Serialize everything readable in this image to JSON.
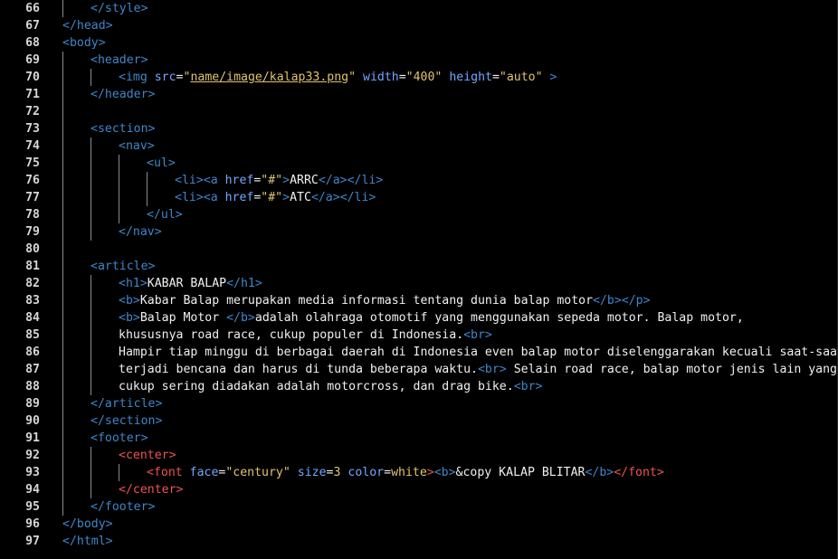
{
  "editor": {
    "colors": {
      "background": "#000000",
      "tag": "#3f86c9",
      "attribute": "#6fa8ff",
      "string": "#e0c46c",
      "center_tag": "#ef5350",
      "text": "#f0f0f0",
      "line_number": "#d6d6d6"
    },
    "lines": [
      {
        "n": "66",
        "indent": 1,
        "tokens": [
          {
            "t": "</style>",
            "c": "tag"
          }
        ]
      },
      {
        "n": "67",
        "indent": 0,
        "tokens": [
          {
            "t": "</head>",
            "c": "tag"
          }
        ]
      },
      {
        "n": "68",
        "indent": 0,
        "tokens": [
          {
            "t": "<body>",
            "c": "tag"
          }
        ]
      },
      {
        "n": "69",
        "indent": 1,
        "tokens": [
          {
            "t": "<header>",
            "c": "tag"
          }
        ]
      },
      {
        "n": "70",
        "indent": 2,
        "tokens": [
          {
            "t": "<img ",
            "c": "tag"
          },
          {
            "t": "src",
            "c": "attr"
          },
          {
            "t": "=",
            "c": "txt"
          },
          {
            "t": "\"",
            "c": "str"
          },
          {
            "t": "name/image/kalap33.png",
            "c": "strl"
          },
          {
            "t": "\"",
            "c": "str"
          },
          {
            "t": " ",
            "c": "txt"
          },
          {
            "t": "width",
            "c": "attr"
          },
          {
            "t": "=",
            "c": "txt"
          },
          {
            "t": "\"400\"",
            "c": "str"
          },
          {
            "t": " ",
            "c": "txt"
          },
          {
            "t": "height",
            "c": "attr"
          },
          {
            "t": "=",
            "c": "txt"
          },
          {
            "t": "\"auto\"",
            "c": "str"
          },
          {
            "t": " >",
            "c": "tag"
          }
        ]
      },
      {
        "n": "71",
        "indent": 1,
        "tokens": [
          {
            "t": "</header>",
            "c": "tag"
          }
        ]
      },
      {
        "n": "72",
        "indent": 0,
        "tokens": []
      },
      {
        "n": "73",
        "indent": 1,
        "tokens": [
          {
            "t": "<section>",
            "c": "tag"
          }
        ]
      },
      {
        "n": "74",
        "indent": 2,
        "tokens": [
          {
            "t": "<nav>",
            "c": "tag"
          }
        ]
      },
      {
        "n": "75",
        "indent": 3,
        "tokens": [
          {
            "t": "<ul>",
            "c": "tag"
          }
        ]
      },
      {
        "n": "76",
        "indent": 4,
        "tokens": [
          {
            "t": "<li><a ",
            "c": "tag"
          },
          {
            "t": "href",
            "c": "attr"
          },
          {
            "t": "=",
            "c": "txt"
          },
          {
            "t": "\"#\"",
            "c": "str"
          },
          {
            "t": ">",
            "c": "tag"
          },
          {
            "t": "ARRC",
            "c": "txt"
          },
          {
            "t": "</a></li>",
            "c": "tag"
          }
        ]
      },
      {
        "n": "77",
        "indent": 4,
        "tokens": [
          {
            "t": "<li><a ",
            "c": "tag"
          },
          {
            "t": "href",
            "c": "attr"
          },
          {
            "t": "=",
            "c": "txt"
          },
          {
            "t": "\"#\"",
            "c": "str"
          },
          {
            "t": ">",
            "c": "tag"
          },
          {
            "t": "ATC",
            "c": "txt"
          },
          {
            "t": "</a></li>",
            "c": "tag"
          }
        ]
      },
      {
        "n": "78",
        "indent": 3,
        "tokens": [
          {
            "t": "</ul>",
            "c": "tag"
          }
        ]
      },
      {
        "n": "79",
        "indent": 2,
        "tokens": [
          {
            "t": "</nav>",
            "c": "tag"
          }
        ]
      },
      {
        "n": "80",
        "indent": 0,
        "tokens": []
      },
      {
        "n": "81",
        "indent": 1,
        "tokens": [
          {
            "t": "<article>",
            "c": "tag"
          }
        ]
      },
      {
        "n": "82",
        "indent": 2,
        "tokens": [
          {
            "t": "<h1>",
            "c": "tag"
          },
          {
            "t": "KABAR BALAP",
            "c": "txt"
          },
          {
            "t": "</h1>",
            "c": "tag"
          }
        ]
      },
      {
        "n": "83",
        "indent": 2,
        "tokens": [
          {
            "t": "<b>",
            "c": "tag"
          },
          {
            "t": "Kabar Balap merupakan media informasi tentang dunia balap motor",
            "c": "txt"
          },
          {
            "t": "</b></p>",
            "c": "tag"
          }
        ]
      },
      {
        "n": "84",
        "indent": 2,
        "tokens": [
          {
            "t": "<b>",
            "c": "tag"
          },
          {
            "t": "Balap Motor ",
            "c": "txt"
          },
          {
            "t": "</b>",
            "c": "tag"
          },
          {
            "t": "adalah olahraga otomotif yang menggunakan sepeda motor. Balap motor,",
            "c": "txt"
          }
        ]
      },
      {
        "n": "85",
        "indent": 2,
        "tokens": [
          {
            "t": "khususnya road race, cukup populer di Indonesia.",
            "c": "txt"
          },
          {
            "t": "<br>",
            "c": "tag"
          }
        ]
      },
      {
        "n": "86",
        "indent": 2,
        "tokens": [
          {
            "t": "Hampir tiap minggu di berbagai daerah di Indonesia even balap motor diselenggarakan kecuali saat-saat",
            "c": "txt"
          }
        ]
      },
      {
        "n": "87",
        "indent": 2,
        "tokens": [
          {
            "t": "terjadi bencana dan harus di tunda beberapa waktu.",
            "c": "txt"
          },
          {
            "t": "<br>",
            "c": "tag"
          },
          {
            "t": " Selain road race, balap motor jenis lain yang",
            "c": "txt"
          }
        ]
      },
      {
        "n": "88",
        "indent": 2,
        "tokens": [
          {
            "t": "cukup sering diadakan adalah motorcross, dan drag bike.",
            "c": "txt"
          },
          {
            "t": "<br>",
            "c": "tag"
          }
        ]
      },
      {
        "n": "89",
        "indent": 1,
        "tokens": [
          {
            "t": "</article>",
            "c": "tag"
          }
        ]
      },
      {
        "n": "90",
        "indent": 1,
        "tokens": [
          {
            "t": "</section>",
            "c": "tag"
          }
        ]
      },
      {
        "n": "91",
        "indent": 1,
        "tokens": [
          {
            "t": "<footer>",
            "c": "tag"
          }
        ]
      },
      {
        "n": "92",
        "indent": 2,
        "tokens": [
          {
            "t": "<center>",
            "c": "red"
          }
        ]
      },
      {
        "n": "93",
        "indent": 3,
        "tokens": [
          {
            "t": "<font ",
            "c": "red"
          },
          {
            "t": "face",
            "c": "attr"
          },
          {
            "t": "=",
            "c": "txt"
          },
          {
            "t": "\"century\"",
            "c": "str"
          },
          {
            "t": " ",
            "c": "txt"
          },
          {
            "t": "size",
            "c": "attr"
          },
          {
            "t": "=",
            "c": "txt"
          },
          {
            "t": "3",
            "c": "str"
          },
          {
            "t": " ",
            "c": "txt"
          },
          {
            "t": "color",
            "c": "attr"
          },
          {
            "t": "=",
            "c": "txt"
          },
          {
            "t": "white",
            "c": "str"
          },
          {
            "t": ">",
            "c": "red"
          },
          {
            "t": "<b>",
            "c": "tag"
          },
          {
            "t": "&copy KALAP BLITAR",
            "c": "txt"
          },
          {
            "t": "</b>",
            "c": "tag"
          },
          {
            "t": "</font>",
            "c": "red"
          }
        ]
      },
      {
        "n": "94",
        "indent": 2,
        "tokens": [
          {
            "t": "</center>",
            "c": "red"
          }
        ]
      },
      {
        "n": "95",
        "indent": 1,
        "tokens": [
          {
            "t": "</footer>",
            "c": "tag"
          }
        ]
      },
      {
        "n": "96",
        "indent": 0,
        "tokens": [
          {
            "t": "</body>",
            "c": "tag"
          }
        ]
      },
      {
        "n": "97",
        "indent": 0,
        "tokens": [
          {
            "t": "</html>",
            "c": "tag"
          }
        ]
      }
    ]
  }
}
